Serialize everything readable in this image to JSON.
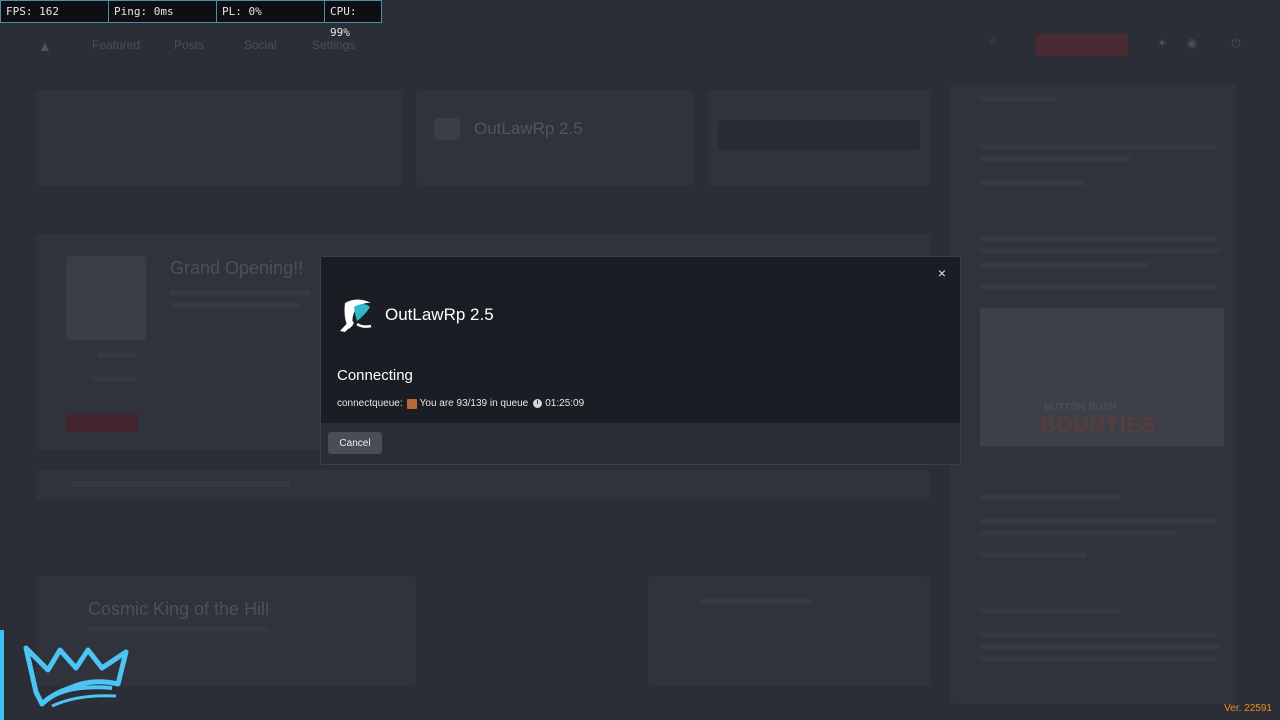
{
  "perf": {
    "fps": "FPS: 162",
    "ping": "Ping: 0ms",
    "pl": "PL: 0%",
    "cpu": "CPU: 99%"
  },
  "background": {
    "featured_server": "OutLawRp 2.5",
    "news_title": "Grand Opening!!",
    "list_item": "Cosmic King of the Hill",
    "bounties_banner": "BOUNTIES",
    "bounties_sub": "BUTTON RUSH"
  },
  "modal": {
    "server_name": "OutLawRp 2.5",
    "status_title": "Connecting",
    "status_prefix": "connectqueue:",
    "queue_text": "You are 93/139 in queue",
    "timer": "01:25:09",
    "cancel_label": "Cancel",
    "close_label": "×"
  },
  "colors": {
    "accent": "#3fc2f0",
    "version_color": "#f08a1e",
    "modal_bg": "#1b1d24"
  },
  "version": "Ver. 22591"
}
